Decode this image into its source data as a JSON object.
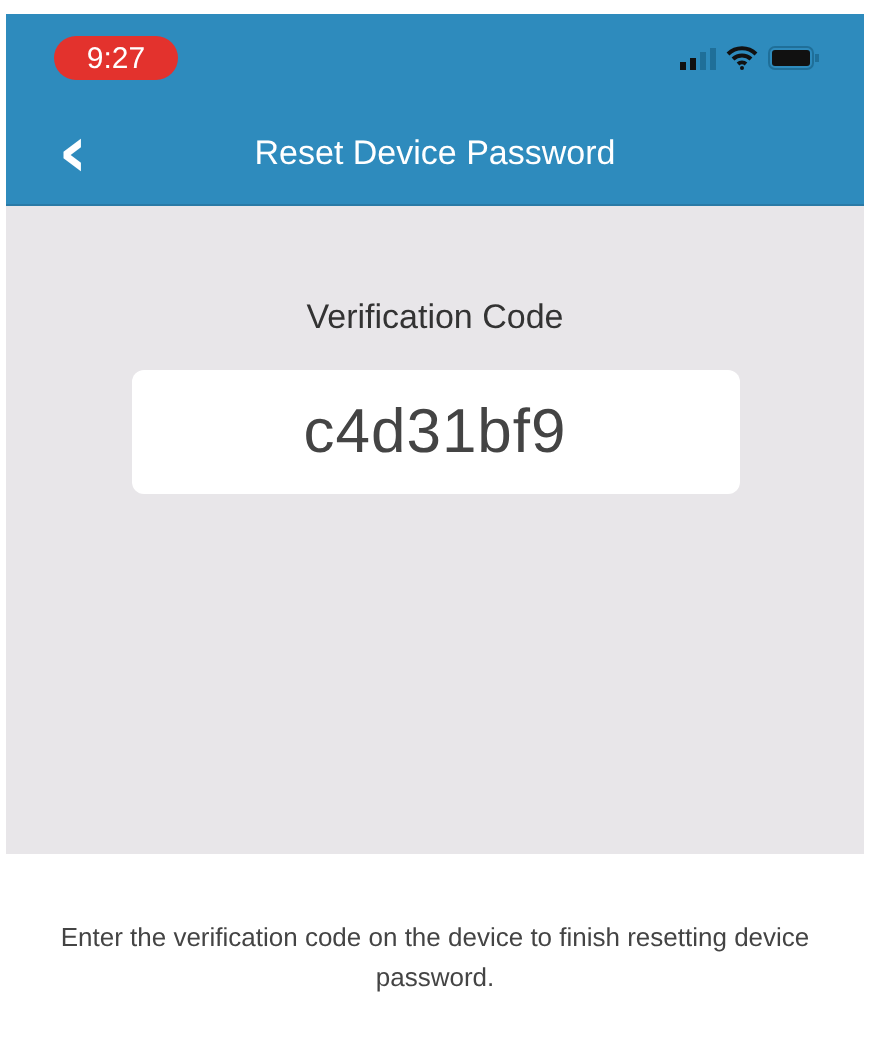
{
  "status_bar": {
    "time": "9:27"
  },
  "header": {
    "back_glyph": "‹",
    "title": "Reset Device Password"
  },
  "code_panel": {
    "label": "Verification Code",
    "code": "c4d31bf9"
  },
  "instructions": "Enter the verification code on the device to finish resetting device password."
}
